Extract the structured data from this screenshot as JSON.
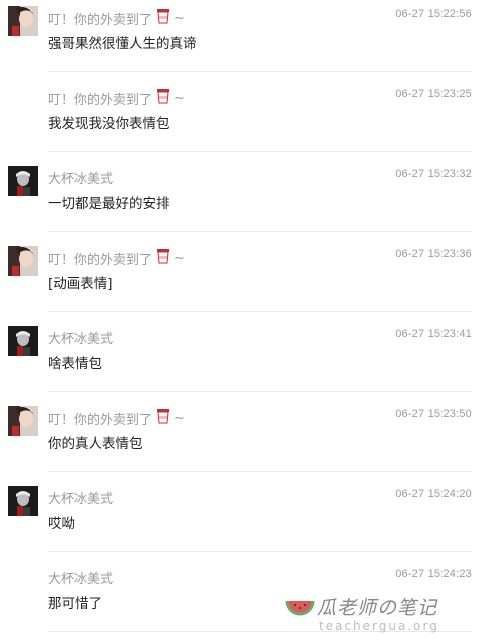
{
  "messages": [
    {
      "sender": "叮！你的外卖到了",
      "has_cup": true,
      "suffix": "~",
      "time": "06-27 15:22:56",
      "text": "强哥果然很懂人生的真谛",
      "avatar": "girl"
    },
    {
      "sender": "叮！你的外卖到了",
      "has_cup": true,
      "suffix": "~",
      "time": "06-27 15:23:25",
      "text": "我发现我没你表情包",
      "avatar": "none"
    },
    {
      "sender": "大杯冰美式",
      "has_cup": false,
      "suffix": "",
      "time": "06-27 15:23:32",
      "text": "一切都是最好的安排",
      "avatar": "boy"
    },
    {
      "sender": "叮！你的外卖到了",
      "has_cup": true,
      "suffix": "~",
      "time": "06-27 15:23:36",
      "text": "[动画表情]",
      "avatar": "girl"
    },
    {
      "sender": "大杯冰美式",
      "has_cup": false,
      "suffix": "",
      "time": "06-27 15:23:41",
      "text": "啥表情包",
      "avatar": "boy"
    },
    {
      "sender": "叮！你的外卖到了",
      "has_cup": true,
      "suffix": "~",
      "time": "06-27 15:23:50",
      "text": "你的真人表情包",
      "avatar": "girl"
    },
    {
      "sender": "大杯冰美式",
      "has_cup": false,
      "suffix": "",
      "time": "06-27 15:24:20",
      "text": "哎呦",
      "avatar": "boy"
    },
    {
      "sender": "大杯冰美式",
      "has_cup": false,
      "suffix": "",
      "time": "06-27 15:24:23",
      "text": "那可惜了",
      "avatar": "none"
    }
  ],
  "watermark": {
    "title": "瓜老师の笔记",
    "url": "teachergua.org"
  }
}
